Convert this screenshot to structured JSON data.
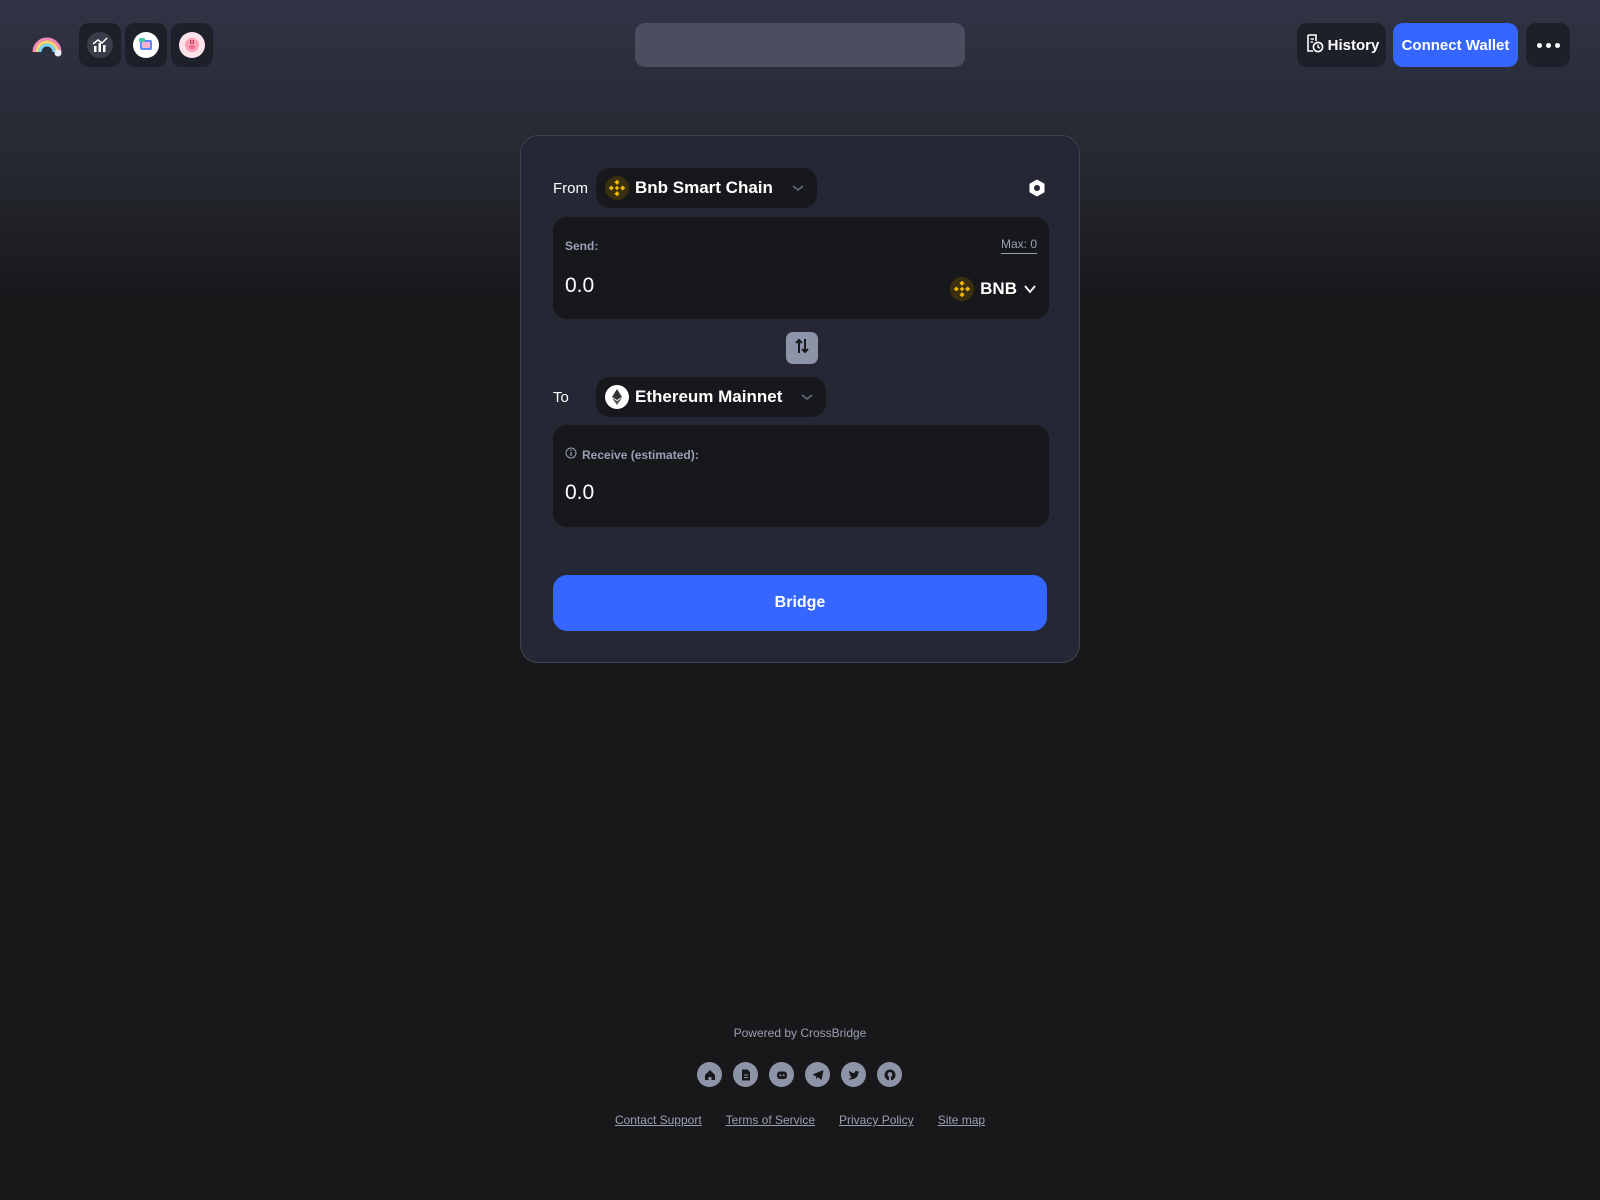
{
  "header": {
    "history_label": "History",
    "connect_label": "Connect Wallet",
    "apps": [
      "chart-app-icon",
      "notebook-app-icon",
      "pig-app-icon"
    ]
  },
  "bridge": {
    "from_label": "From",
    "from_chain": "Bnb Smart Chain",
    "send_label": "Send:",
    "max_label": "Max: 0",
    "send_amount": "0.0",
    "token": "BNB",
    "to_label": "To",
    "to_chain": "Ethereum Mainnet",
    "receive_label": "Receive (estimated):",
    "receive_amount": "0.0",
    "bridge_label": "Bridge"
  },
  "footer": {
    "powered": "Powered by CrossBridge",
    "links": [
      "Contact Support",
      "Terms of Service",
      "Privacy Policy",
      "Site map"
    ],
    "socials": [
      "home-icon",
      "docs-icon",
      "discord-icon",
      "telegram-icon",
      "twitter-icon",
      "github-icon"
    ]
  },
  "colors": {
    "accent": "#3566ff",
    "card": "#252834",
    "panel": "#17181c",
    "bnb": "#f0b90b"
  }
}
